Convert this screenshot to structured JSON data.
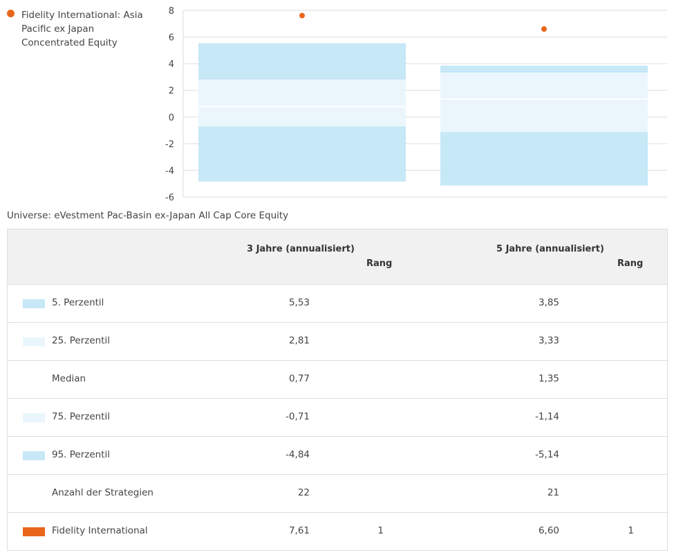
{
  "legend": {
    "fund_name": "Fidelity International: Asia Pacific ex Japan Concentrated Equity",
    "fund_color": "#e8651b"
  },
  "chart_data": {
    "type": "box",
    "categories": [
      "3 Jahre (annualisiert)",
      "5 Jahre (annualisiert)"
    ],
    "ylim": [
      -6,
      8
    ],
    "yticks": [
      8,
      6,
      4,
      2,
      0,
      -2,
      -4,
      -6
    ],
    "grid": true,
    "legend_position": "top-left",
    "percentiles": {
      "p5": [
        5.53,
        3.85
      ],
      "p25": [
        2.81,
        3.33
      ],
      "median": [
        0.77,
        1.35
      ],
      "p75": [
        -0.71,
        -1.14
      ],
      "p95": [
        -4.84,
        -5.14
      ]
    },
    "series": [
      {
        "name": "Fidelity International",
        "values": [
          7.61,
          6.6
        ]
      }
    ],
    "colors": {
      "outer_band": "#c6e8f7",
      "inner_band": "#eaf6fc",
      "median_line": "#ffffff",
      "fund_marker": "#e8651b",
      "gridline": "#dddddd",
      "axis_text": "#444444"
    }
  },
  "universe_label": "Universe: eVestment Pac-Basin ex-Japan All Cap Core Equity",
  "table": {
    "period1_header": "3 Jahre (annualisiert)",
    "period2_header": "5 Jahre (annualisiert)",
    "rank_header": "Rang",
    "rows": [
      {
        "label": "5. Perzentil",
        "swatch": "#c6e8f7",
        "v1": "5,53",
        "r1": "",
        "v2": "3,85",
        "r2": ""
      },
      {
        "label": "25. Perzentil",
        "swatch": "#eaf6fc",
        "v1": "2,81",
        "r1": "",
        "v2": "3,33",
        "r2": ""
      },
      {
        "label": "Median",
        "swatch": "",
        "v1": "0,77",
        "r1": "",
        "v2": "1,35",
        "r2": ""
      },
      {
        "label": "75. Perzentil",
        "swatch": "#eaf6fc",
        "v1": "-0,71",
        "r1": "",
        "v2": "-1,14",
        "r2": ""
      },
      {
        "label": "95. Perzentil",
        "swatch": "#c6e8f7",
        "v1": "-4,84",
        "r1": "",
        "v2": "-5,14",
        "r2": ""
      },
      {
        "label": "Anzahl der Strategien",
        "swatch": "",
        "v1": "22",
        "r1": "",
        "v2": "21",
        "r2": ""
      },
      {
        "label": "Fidelity International",
        "swatch": "#e8651b",
        "v1": "7,61",
        "r1": "1",
        "v2": "6,60",
        "r2": "1"
      }
    ]
  }
}
